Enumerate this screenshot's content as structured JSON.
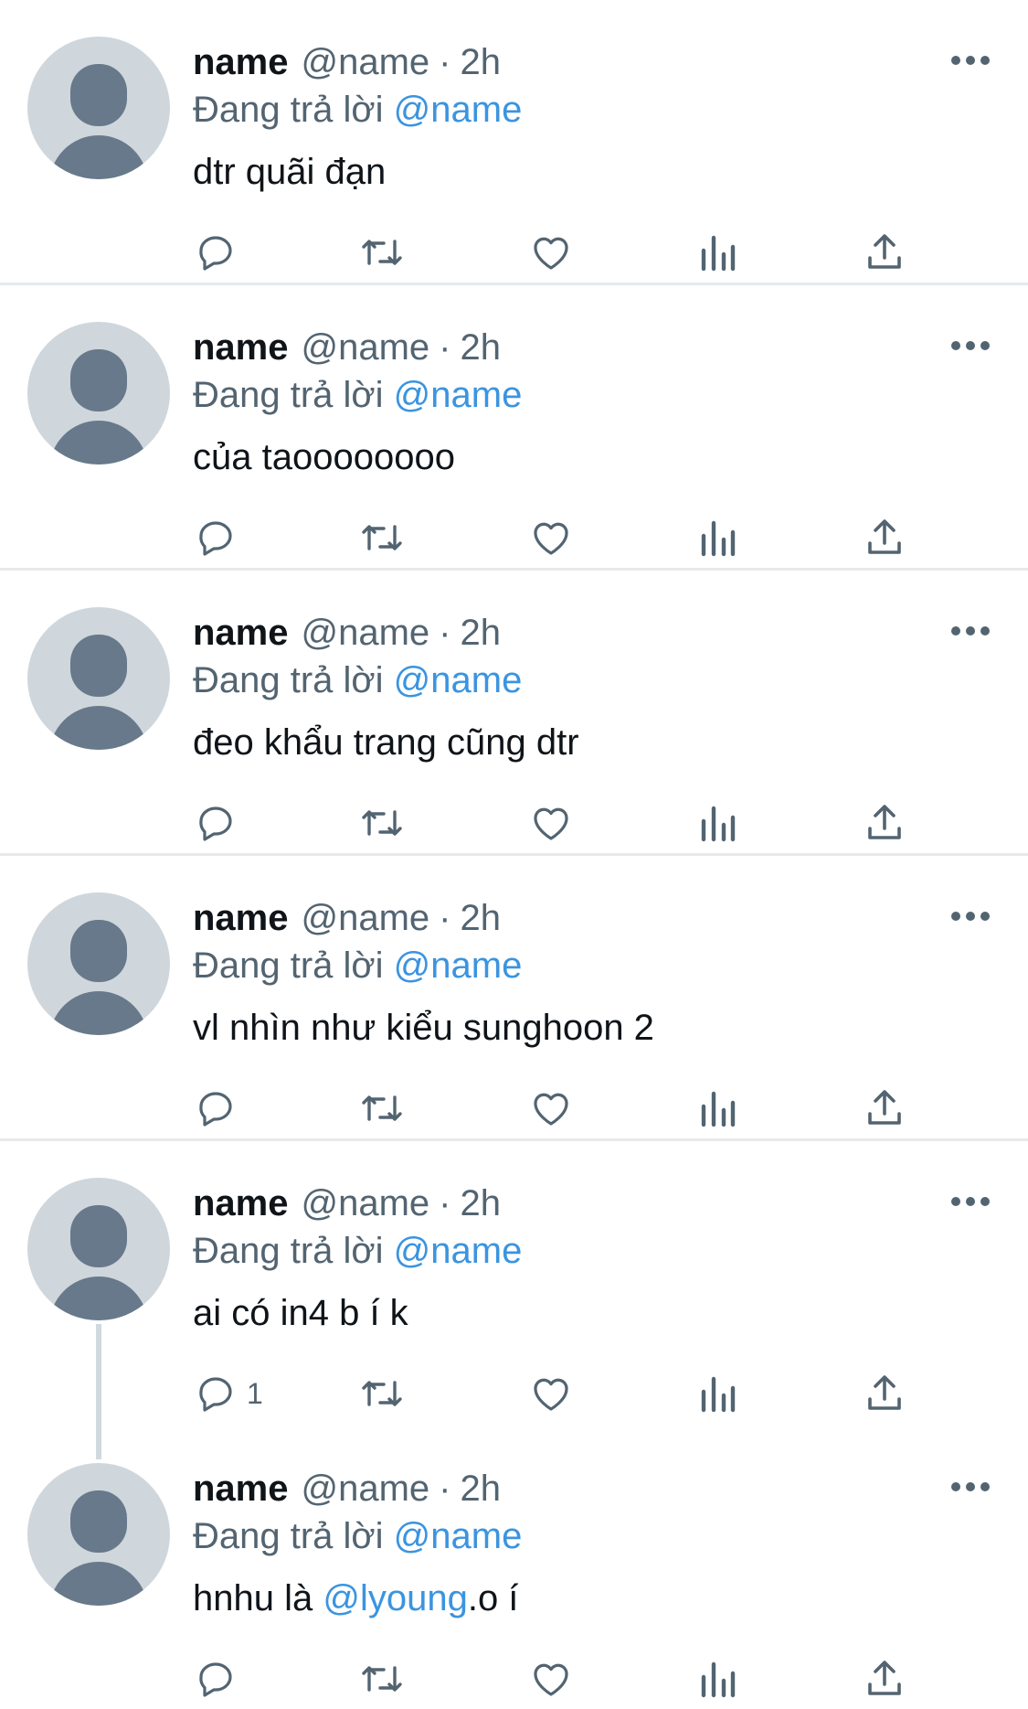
{
  "reply_prefix": "Đang trả lời",
  "tweets": [
    {
      "name": "name",
      "handle": "@name",
      "time": "2h",
      "reply_to": "@name",
      "text": "dtr quãi đạn",
      "reply_count": ""
    },
    {
      "name": "name",
      "handle": "@name",
      "time": "2h",
      "reply_to": "@name",
      "text": "của taoooooooo",
      "reply_count": ""
    },
    {
      "name": "name",
      "handle": "@name",
      "time": "2h",
      "reply_to": "@name",
      "text": "đeo khẩu trang cũng dtr",
      "reply_count": ""
    },
    {
      "name": "name",
      "handle": "@name",
      "time": "2h",
      "reply_to": "@name",
      "text": "vl nhìn như kiểu sunghoon 2",
      "reply_count": ""
    },
    {
      "name": "name",
      "handle": "@name",
      "time": "2h",
      "reply_to": "@name",
      "text": "ai có in4 b í k",
      "reply_count": "1"
    },
    {
      "name": "name",
      "handle": "@name",
      "time": "2h",
      "reply_to": "@name",
      "text_before": "hnhu là ",
      "text_mention": "@lyoung",
      "text_after": ".o í",
      "reply_count": ""
    }
  ],
  "icons": {
    "reply": "reply-icon",
    "retweet": "retweet-icon",
    "like": "heart-icon",
    "views": "analytics-icon",
    "share": "share-icon",
    "more": "more-icon"
  },
  "colors": {
    "link": "#3b94e0",
    "muted": "#536471",
    "avatar_bg": "#cfd6dc",
    "avatar_fg": "#67798a",
    "divider": "#e7e9eb"
  }
}
